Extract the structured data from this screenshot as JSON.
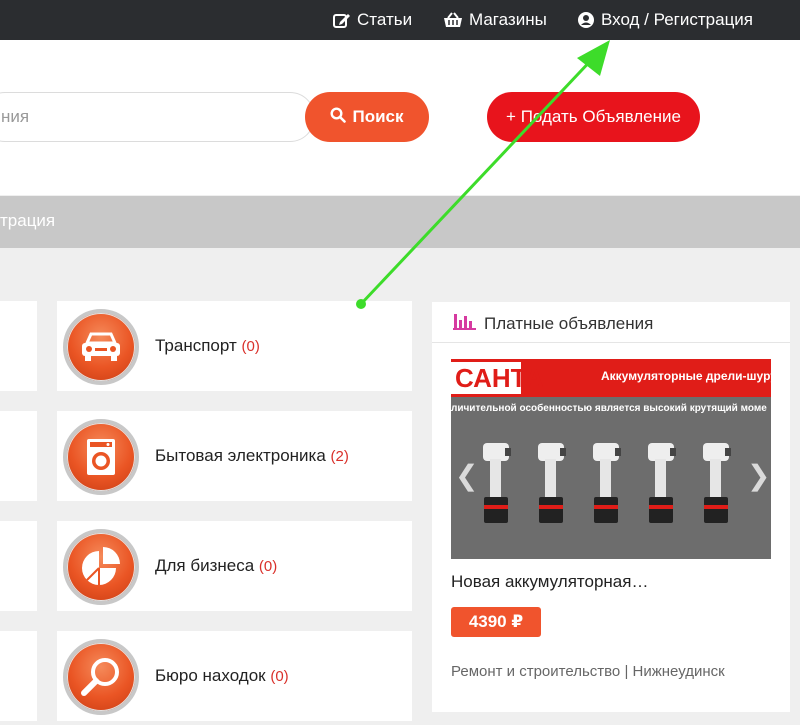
{
  "topnav": {
    "articles": "Статьи",
    "shops": "Магазины",
    "login": "Вход / Регистрация"
  },
  "search": {
    "placeholder": "ния",
    "button": "Поиск"
  },
  "post_ad": "+ Подать Объявление",
  "banner_text": "трация",
  "categories": [
    {
      "label": "Транспорт",
      "count": "(0)",
      "icon": "car-icon"
    },
    {
      "label": "Бытовая электроника",
      "count": "(2)",
      "icon": "washing-machine-icon"
    },
    {
      "label": "Для бизнеса",
      "count": "(0)",
      "icon": "pie-chart-icon"
    },
    {
      "label": "Бюро находок",
      "count": "(0)",
      "icon": "magnifier-icon"
    }
  ],
  "paid": {
    "header": "Платные объявления",
    "image_brand": "САНТА",
    "image_slogan": "Аккумуляторные дрели-шуруповё",
    "image_sub": "личительной особенностью является высокий крутящий моме",
    "title": "Новая аккумуляторная…",
    "price": "4390 ₽",
    "meta": "Ремонт и строительство | Нижнеудинск"
  },
  "colors": {
    "topbar": "#2b2d30",
    "search_button": "#f0542d",
    "post_button": "#e8141c",
    "category_icon": "#ea5524",
    "count": "#d9302a",
    "annotation_arrow": "#3ddc2a"
  }
}
